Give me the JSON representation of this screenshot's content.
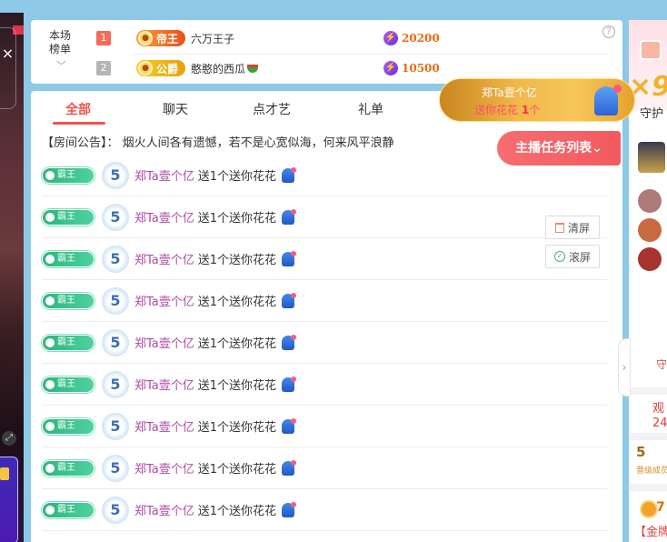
{
  "left_strip": {
    "close_symbol": "×",
    "expand_symbol": "⤢"
  },
  "rank": {
    "title": "本场榜单",
    "arrow": "﹀",
    "help": "?",
    "rows": [
      {
        "num": "1",
        "badge": "帝王",
        "name": "六万王子",
        "score": "20200"
      },
      {
        "num": "2",
        "badge": "公爵",
        "name": "憨憨的西瓜",
        "score": "10500"
      }
    ]
  },
  "tabs": [
    "全部",
    "聊天",
    "点才艺",
    "礼单"
  ],
  "notice": "【房间公告】： 烟火人间各有遗憾，若不是心宽似海，何来风平浪静",
  "task_button": "主播任务列表⌄",
  "gift_popup": {
    "user": "郑Ta壹个亿",
    "gift_prefix": "送你花花",
    "count": "1",
    "unit": "个"
  },
  "messages": [
    {
      "user": "郑Ta壹个亿",
      "text": "送1个送你花花",
      "level": "5"
    },
    {
      "user": "郑Ta壹个亿",
      "text": "送1个送你花花",
      "level": "5"
    },
    {
      "user": "郑Ta壹个亿",
      "text": "送1个送你花花",
      "level": "5"
    },
    {
      "user": "郑Ta壹个亿",
      "text": "送1个送你花花",
      "level": "5"
    },
    {
      "user": "郑Ta壹个亿",
      "text": "送1个送你花花",
      "level": "5"
    },
    {
      "user": "郑Ta壹个亿",
      "text": "送1个送你花花",
      "level": "5"
    },
    {
      "user": "郑Ta壹个亿",
      "text": "送1个送你花花",
      "level": "5"
    },
    {
      "user": "郑Ta壹个亿",
      "text": "送1个送你花花",
      "level": "5"
    },
    {
      "user": "郑Ta壹个亿",
      "text": "送1个送你花花",
      "level": "5"
    }
  ],
  "fan_badge": "霸王",
  "side_buttons": {
    "clear": "清屏",
    "scroll": "滚屏"
  },
  "right": {
    "multiplier": "×9",
    "guard": "守护",
    "guard_small": "守",
    "viewers_label": "观",
    "viewers_count": "24",
    "level": "5",
    "level_sub": "晋级成员",
    "gold_count": "7",
    "gold_label": "【金牌"
  }
}
